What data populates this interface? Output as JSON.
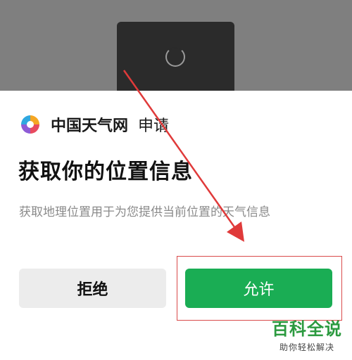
{
  "dialog": {
    "app_name": "中国天气网",
    "action": "申请",
    "title": "获取你的位置信息",
    "description": "获取地理位置用于为您提供当前位置的天气信息",
    "deny_label": "拒绝",
    "allow_label": "允许",
    "allow_color": "#1aad54"
  },
  "watermark": {
    "brand": "百科全说",
    "tagline": "助你轻松解决"
  }
}
